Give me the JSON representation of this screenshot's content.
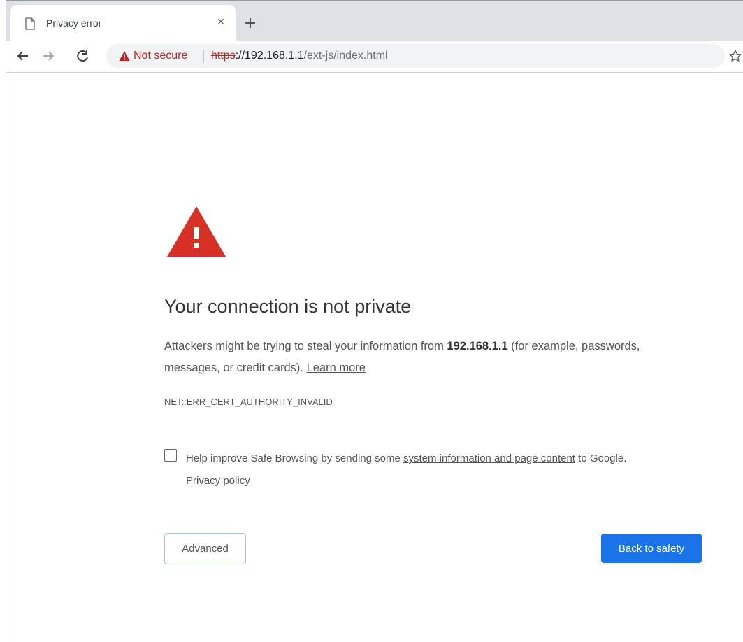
{
  "browser": {
    "tab": {
      "title": "Privacy error",
      "close_glyph": "×",
      "icon": "page-icon"
    },
    "new_tab_icon": "plus-icon",
    "toolbar": {
      "back_icon": "back-arrow-icon",
      "forward_icon": "forward-arrow-icon",
      "reload_icon": "reload-icon",
      "security_label": "Not secure",
      "url_scheme": "https",
      "url_rest_host": "://192.168.1.1",
      "url_path": "/ext-js/index.html",
      "bookmark_icon": "star-icon"
    }
  },
  "page": {
    "warning_icon": "warning-triangle-icon",
    "heading": "Your connection is not private",
    "explain_prefix": "Attackers might be trying to steal your information from ",
    "explain_host": "192.168.1.1",
    "explain_suffix": " (for example, passwords, messages, or credit cards). ",
    "learn_more": "Learn more",
    "error_code": "NET::ERR_CERT_AUTHORITY_INVALID",
    "safe_browsing": {
      "prefix": "Help improve Safe Browsing by sending some ",
      "link": "system information and page content",
      "suffix": " to Google.",
      "privacy_link": "Privacy policy"
    },
    "advanced_button": "Advanced",
    "back_button": "Back to safety"
  },
  "colors": {
    "danger": "#c5221f",
    "primary": "#1a73e8",
    "warning_triangle": "#d93025"
  }
}
